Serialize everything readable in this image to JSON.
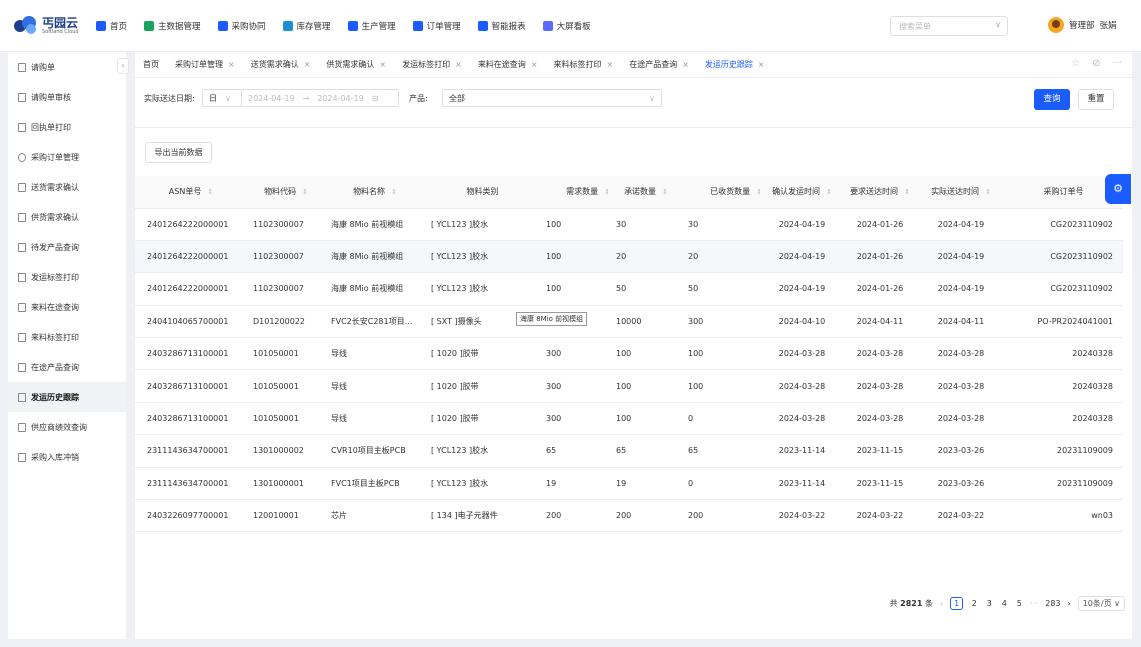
{
  "app": {
    "logo_text": "丐园云",
    "logo_sub": "Softland Cloud"
  },
  "nav": [
    {
      "label": "首页",
      "color": "#1a5cff"
    },
    {
      "label": "主数据管理",
      "color": "#1aa260"
    },
    {
      "label": "采购协同",
      "color": "#1a5cff"
    },
    {
      "label": "库存管理",
      "color": "#1a8fd6"
    },
    {
      "label": "生产管理",
      "color": "#1a5cff"
    },
    {
      "label": "订单管理",
      "color": "#1a5cff"
    },
    {
      "label": "智能报表",
      "color": "#1a5cff"
    },
    {
      "label": "大屏看板",
      "color": "#5a6cff"
    }
  ],
  "menu_search": {
    "placeholder": "搜索菜单"
  },
  "user": {
    "dept": "管理部",
    "name": "张娟"
  },
  "sidebar": [
    {
      "label": "请购单",
      "icon": "doc-icon"
    },
    {
      "label": "请购单审核",
      "icon": "doc-icon"
    },
    {
      "label": "回执单打印",
      "icon": "doc-icon"
    },
    {
      "label": "采购订单管理",
      "icon": "gear-icon"
    },
    {
      "label": "送货需求确认",
      "icon": "doc-icon"
    },
    {
      "label": "供货需求确认",
      "icon": "doc-icon"
    },
    {
      "label": "待发产品查询",
      "icon": "doc-icon"
    },
    {
      "label": "发运标签打印",
      "icon": "doc-icon"
    },
    {
      "label": "来料在途查询",
      "icon": "doc-icon"
    },
    {
      "label": "来料标签打印",
      "icon": "doc-icon"
    },
    {
      "label": "在途产品查询",
      "icon": "doc-icon"
    },
    {
      "label": "发运历史跟踪",
      "icon": "doc-icon",
      "active": true
    },
    {
      "label": "供应商绩效查询",
      "icon": "doc-icon"
    },
    {
      "label": "采购入库冲销",
      "icon": "doc-icon"
    }
  ],
  "tabs": [
    {
      "label": "首页",
      "closable": false
    },
    {
      "label": "采购订单管理",
      "closable": true
    },
    {
      "label": "送货需求确认",
      "closable": true
    },
    {
      "label": "供货需求确认",
      "closable": true
    },
    {
      "label": "发运标签打印",
      "closable": true
    },
    {
      "label": "来料在途查询",
      "closable": true
    },
    {
      "label": "来料标签打印",
      "closable": true
    },
    {
      "label": "在途产品查询",
      "closable": true
    },
    {
      "label": "发运历史跟踪",
      "closable": true,
      "active": true
    }
  ],
  "filter": {
    "date_label": "实际送达日期:",
    "date_unit": "日",
    "date_start": "2024-04-19",
    "date_end": "2024-04-19",
    "product_label": "产品:",
    "product_value": "全部",
    "query": "查询",
    "reset": "重置"
  },
  "export_label": "导出当前数据",
  "table": {
    "columns": [
      "ASN单号",
      "物料代码",
      "物料名称",
      "物料类别",
      "需求数量",
      "承诺数量",
      "已收货数量",
      "确认发运时间",
      "要求送达时间",
      "实际送达时间",
      "采购订单号"
    ],
    "rows": [
      [
        "2401264222000001",
        "1102300007",
        "海康 8Mio 前视模组",
        "[ YCL123 ]胶水",
        "100",
        "30",
        "30",
        "2024-04-19",
        "2024-01-26",
        "2024-04-19",
        "CG2023110902"
      ],
      [
        "2401264222000001",
        "1102300007",
        "海康 8Mio 前视模组",
        "[ YCL123 ]胶水",
        "100",
        "20",
        "20",
        "2024-04-19",
        "2024-01-26",
        "2024-04-19",
        "CG2023110902"
      ],
      [
        "2401264222000001",
        "1102300007",
        "海康 8Mio 前视模组",
        "[ YCL123 ]胶水",
        "100",
        "50",
        "50",
        "2024-04-19",
        "2024-01-26",
        "2024-04-19",
        "CG2023110902"
      ],
      [
        "2404104065700001",
        "D101200022",
        "FVC2长安C281项目...",
        "[ SXT ]摄像头",
        "10000",
        "10000",
        "300",
        "2024-04-10",
        "2024-04-11",
        "2024-04-11",
        "PO-PR2024041001"
      ],
      [
        "2403286713100001",
        "101050001",
        "导线",
        "[ 1020 ]胶带",
        "300",
        "100",
        "100",
        "2024-03-28",
        "2024-03-28",
        "2024-03-28",
        "20240328"
      ],
      [
        "2403286713100001",
        "101050001",
        "导线",
        "[ 1020 ]胶带",
        "300",
        "100",
        "100",
        "2024-03-28",
        "2024-03-28",
        "2024-03-28",
        "20240328"
      ],
      [
        "2403286713100001",
        "101050001",
        "导线",
        "[ 1020 ]胶带",
        "300",
        "100",
        "0",
        "2024-03-28",
        "2024-03-28",
        "2024-03-28",
        "20240328"
      ],
      [
        "2311143634700001",
        "1301000002",
        "CVR10项目主板PCB",
        "[ YCL123 ]胶水",
        "65",
        "65",
        "65",
        "2023-11-14",
        "2023-11-15",
        "2023-03-26",
        "20231109009"
      ],
      [
        "2311143634700001",
        "1301000001",
        "FVC1项目主板PCB",
        "[ YCL123 ]胶水",
        "19",
        "19",
        "0",
        "2023-11-14",
        "2023-11-15",
        "2023-03-26",
        "20231109009"
      ],
      [
        "2403226097700001",
        "120010001",
        "芯片",
        "[ 134 ]电子元器件",
        "200",
        "200",
        "200",
        "2024-03-22",
        "2024-03-22",
        "2024-03-22",
        "wn03"
      ]
    ]
  },
  "tooltip": "海康 8Mio 前视模组",
  "pagination": {
    "total_prefix": "共",
    "total": "2821",
    "total_suffix": "条",
    "pages": [
      "1",
      "2",
      "3",
      "4",
      "5",
      "···",
      "283"
    ],
    "current": "1",
    "page_size": "10条/页"
  }
}
